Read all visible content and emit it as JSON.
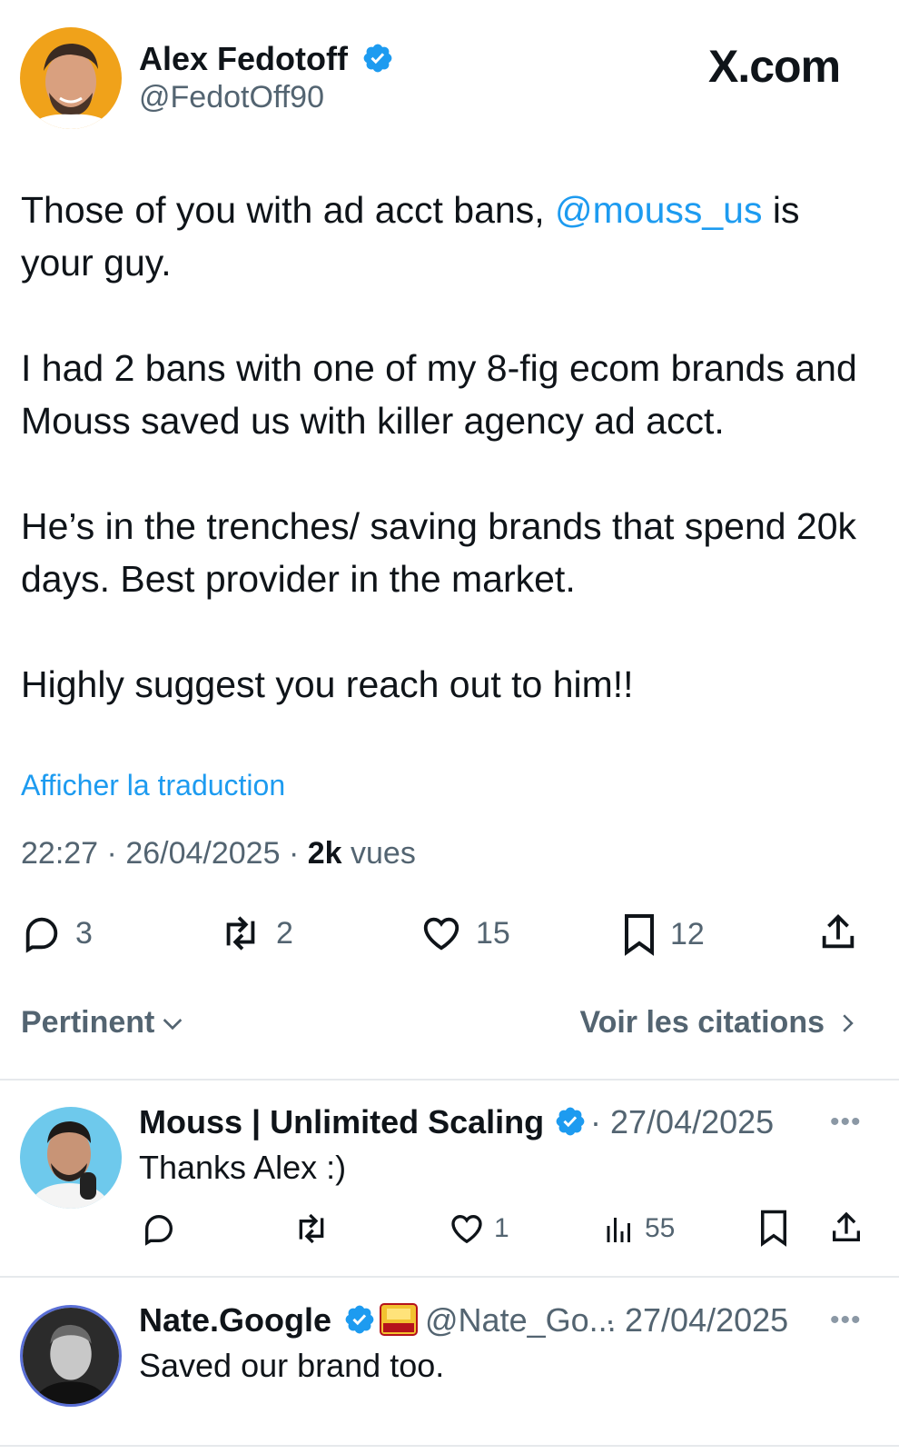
{
  "brand": "X.com",
  "tweet": {
    "author_name": "Alex Fedotoff",
    "author_handle": "@FedotOff90",
    "text_before_mention": "Those of you with ad acct bans, ",
    "mention": "@mouss_us",
    "text_after_mention": " is your guy.\n\nI had 2 bans with one of my 8-fig ecom brands and Mouss saved us with killer agency ad acct.\n\nHe’s in the trenches/ saving brands that spend 20k days. Best provider in the market.\n\nHighly suggest you reach out to him!!",
    "translate_link": "Afficher la traduction",
    "time": "22:27",
    "date": "26/04/2025",
    "views_count": "2k",
    "views_label": "vues",
    "replies": "3",
    "reposts": "2",
    "likes": "15",
    "bookmarks": "12"
  },
  "sort_label": "Pertinent",
  "quotes_label": "Voir les citations",
  "replies": [
    {
      "name": "Mouss | Unlimited Scaling",
      "date": "27/04/2025",
      "text": "Thanks Alex :)",
      "likes": "1",
      "views": "55"
    },
    {
      "name": "Nate.Google",
      "handle": "@Nate_Go...",
      "date": "27/04/2025",
      "text": "Saved our brand too."
    }
  ],
  "colors": {
    "accent": "#1d9bf0",
    "text": "#0f1419",
    "secondary": "#536471"
  },
  "icons": [
    "verified-badge-icon",
    "reply-icon",
    "repost-icon",
    "like-icon",
    "bookmark-icon",
    "share-icon",
    "views-icon",
    "chevron-down-icon",
    "chevron-right-icon",
    "more-icon"
  ]
}
